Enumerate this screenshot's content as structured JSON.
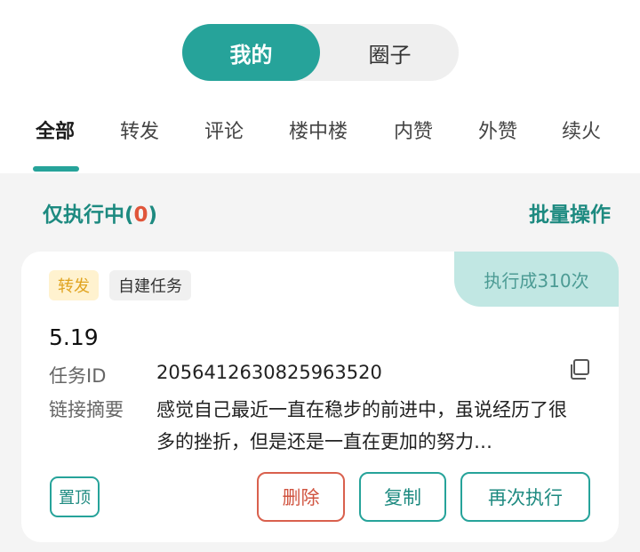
{
  "segment": {
    "mine": "我的",
    "circle": "圈子"
  },
  "tabs": [
    "全部",
    "转发",
    "评论",
    "楼中楼",
    "内赞",
    "外赞",
    "续火"
  ],
  "filter": {
    "label_prefix": "仅执行中(",
    "count": "0",
    "label_suffix": ")",
    "batch": "批量操作"
  },
  "card": {
    "ribbon": "执行成310次",
    "chips": [
      "转发",
      "自建任务"
    ],
    "title": "5.19",
    "id_label": "任务ID",
    "id_value": "2056412630825963520",
    "summary_label": "链接摘要",
    "summary_value": "感觉自己最近一直在稳步的前进中，虽说经历了很多的挫折，但是还是一直在更加的努力…",
    "pin": "置顶",
    "delete": "删除",
    "copy": "复制",
    "rerun": "再次执行"
  },
  "colors": {
    "accent": "#26a39a",
    "accent_text": "#1d8a80",
    "danger": "#d0533f",
    "ribbon_bg": "#c1e7e3",
    "chip_forward_bg": "#fff2cf",
    "chip_forward_text": "#e0a31f"
  },
  "icons": {
    "copy": "copy-icon"
  }
}
